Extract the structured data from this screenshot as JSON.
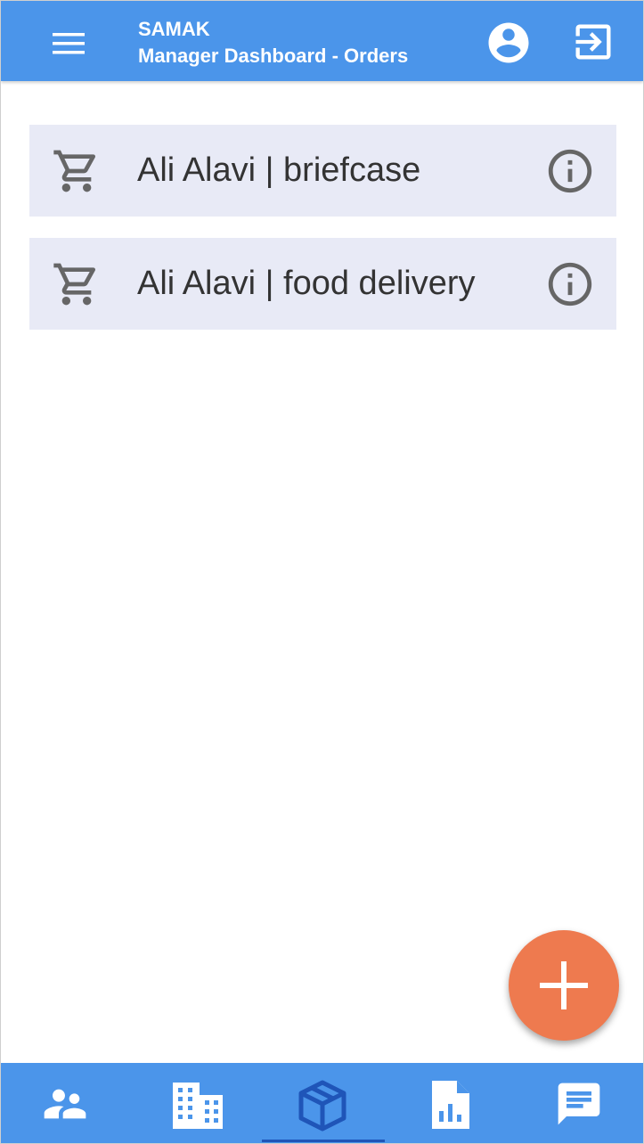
{
  "appbar": {
    "title": "SAMAK",
    "subtitle": "Manager Dashboard - Orders",
    "icons": {
      "menu": "menu-icon",
      "account": "account-circle-icon",
      "logout": "exit-to-app-icon"
    }
  },
  "orders": [
    {
      "label": "Ali Alavi | briefcase",
      "icon": "shopping-cart-icon",
      "action_icon": "info-icon"
    },
    {
      "label": "Ali Alavi | food delivery",
      "icon": "shopping-cart-icon",
      "action_icon": "info-icon"
    }
  ],
  "fab": {
    "icon": "add-icon"
  },
  "bottom_nav": {
    "items": [
      {
        "id": "people",
        "icon": "people-icon",
        "active": false
      },
      {
        "id": "buildings",
        "icon": "building-icon",
        "active": false
      },
      {
        "id": "orders",
        "icon": "package-icon",
        "active": true
      },
      {
        "id": "reports",
        "icon": "report-chart-icon",
        "active": false
      },
      {
        "id": "messages",
        "icon": "chat-icon",
        "active": false
      }
    ]
  },
  "colors": {
    "primary": "#4b95ea",
    "list_item_bg": "#e8eaf6",
    "fab": "#ee7a4f",
    "active_nav": "#1f55b8",
    "icon_gray": "#666666"
  }
}
